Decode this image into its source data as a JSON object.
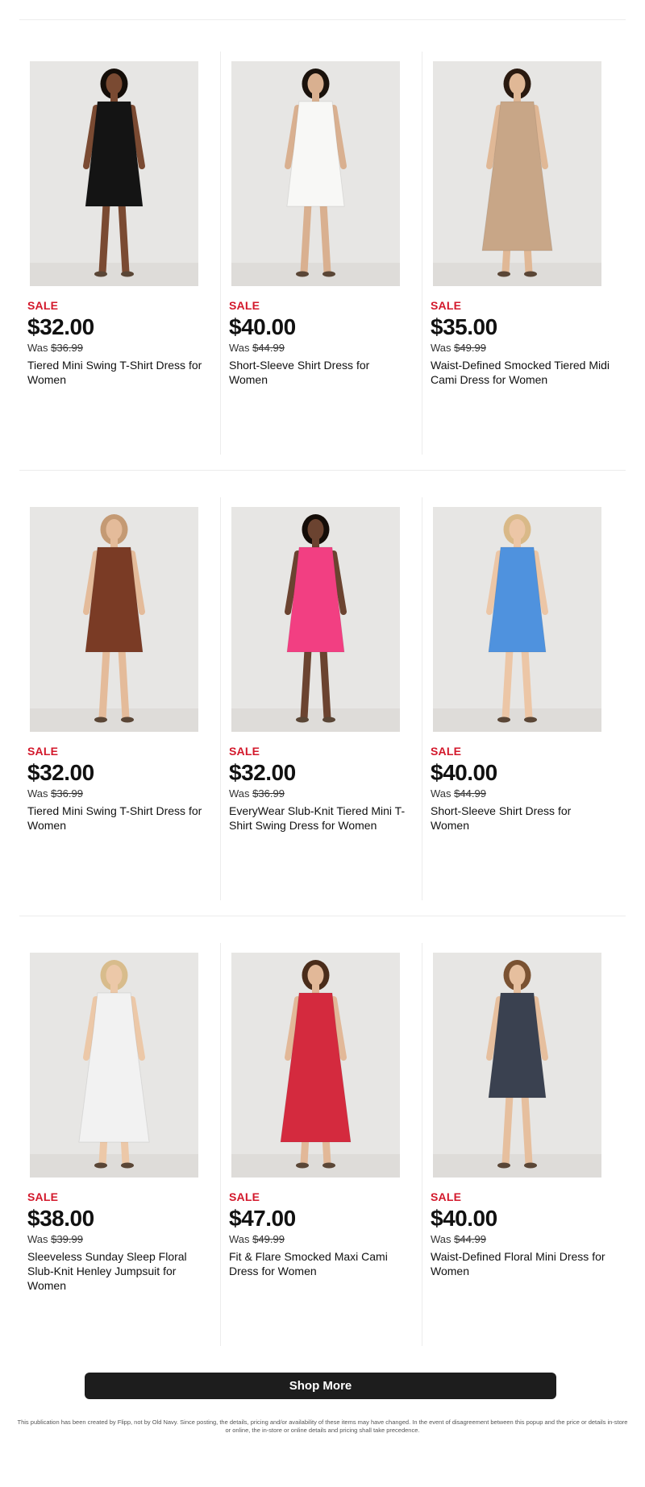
{
  "products": [
    {
      "sale_label": "SALE",
      "price": "$32.00",
      "was_label": "Was",
      "was_price": "$36.99",
      "name": "Tiered Mini Swing T-Shirt Dress for Women",
      "dress_color": "#141414",
      "skin_color": "#7a4a32",
      "hair_color": "#140d08"
    },
    {
      "sale_label": "SALE",
      "price": "$40.00",
      "was_label": "Was",
      "was_price": "$44.99",
      "name": "Short-Sleeve Shirt Dress for Women",
      "dress_color": "#f8f8f6",
      "skin_color": "#d9b090",
      "hair_color": "#1a120c"
    },
    {
      "sale_label": "SALE",
      "price": "$35.00",
      "was_label": "Was",
      "was_price": "$49.99",
      "name": "Waist-Defined Smocked Tiered Midi Cami Dress for Women",
      "dress_color": "#c8a687",
      "skin_color": "#e0b896",
      "hair_color": "#2a1a10"
    },
    {
      "sale_label": "SALE",
      "price": "$32.00",
      "was_label": "Was",
      "was_price": "$36.99",
      "name": "Tiered Mini Swing T-Shirt Dress for Women",
      "dress_color": "#7a3b25",
      "skin_color": "#e4bb9a",
      "hair_color": "#c49a74"
    },
    {
      "sale_label": "SALE",
      "price": "$32.00",
      "was_label": "Was",
      "was_price": "$36.99",
      "name": "EveryWear Slub-Knit Tiered Mini T-Shirt Swing Dress for Women",
      "dress_color": "#f23f82",
      "skin_color": "#6b4330",
      "hair_color": "#140d08"
    },
    {
      "sale_label": "SALE",
      "price": "$40.00",
      "was_label": "Was",
      "was_price": "$44.99",
      "name": "Short-Sleeve Shirt Dress for Women",
      "dress_color": "#4f92de",
      "skin_color": "#ecc6a6",
      "hair_color": "#d9b988"
    },
    {
      "sale_label": "SALE",
      "price": "$38.00",
      "was_label": "Was",
      "was_price": "$39.99",
      "name": "Sleeveless Sunday Sleep Floral Slub-Knit Henley Jumpsuit for Women",
      "dress_color": "#f2f2f2",
      "skin_color": "#ecc8a8",
      "hair_color": "#d8bc8c"
    },
    {
      "sale_label": "SALE",
      "price": "$47.00",
      "was_label": "Was",
      "was_price": "$49.99",
      "name": "Fit & Flare Smocked Maxi Cami Dress for Women",
      "dress_color": "#d42a3e",
      "skin_color": "#e2b898",
      "hair_color": "#4a2c1a"
    },
    {
      "sale_label": "SALE",
      "price": "$40.00",
      "was_label": "Was",
      "was_price": "$44.99",
      "name": "Waist-Defined Floral Mini Dress for Women",
      "dress_color": "#3a4150",
      "skin_color": "#e6bf9e",
      "hair_color": "#7a5232"
    }
  ],
  "footer": {
    "shop_more_label": "Shop More",
    "disclaimer": "This publication has been created by Flipp, not by Old Navy. Since posting, the details, pricing and/or availability of these items may have changed. In the event of disagreement between this popup and the price or details in-store or online, the in-store or online details and pricing shall take precedence."
  },
  "colors": {
    "sale": "#d3182b",
    "button_bg": "#1d1d1d",
    "image_bg": "#e7e6e4"
  }
}
